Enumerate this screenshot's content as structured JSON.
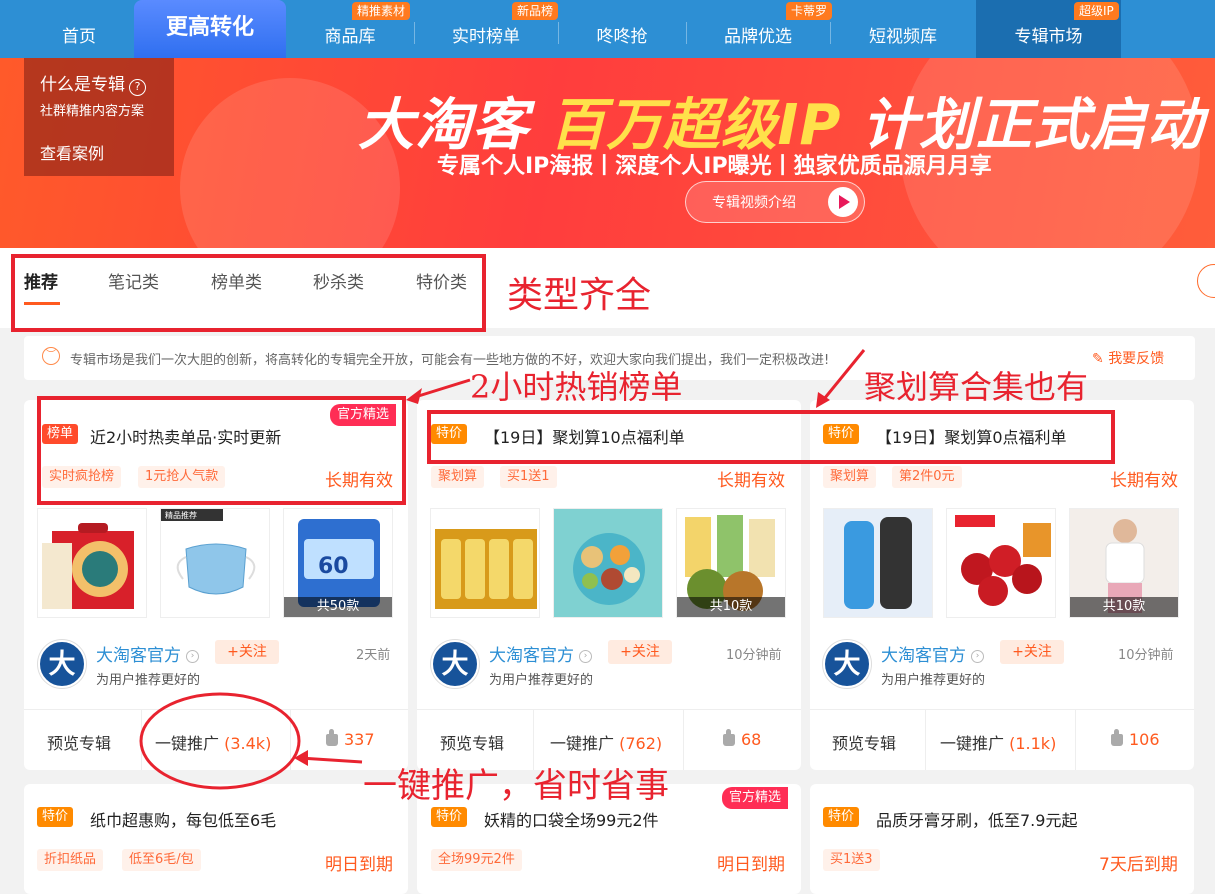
{
  "nav": {
    "items": [
      {
        "label": "首页",
        "badge": ""
      },
      {
        "label": "更高转化",
        "badge": ""
      },
      {
        "label": "商品库",
        "badge": "精推素材"
      },
      {
        "label": "实时榜单",
        "badge": "新品榜"
      },
      {
        "label": "咚咚抢",
        "badge": ""
      },
      {
        "label": "品牌优选",
        "badge": "卡蒂罗"
      },
      {
        "label": "短视频库",
        "badge": ""
      },
      {
        "label": "专辑市场",
        "badge": "超级IP"
      }
    ]
  },
  "banner": {
    "side": {
      "title": "什么是专辑",
      "help": "?",
      "subtitle": "社群精推内容方案",
      "link": "查看案例"
    },
    "title_a": "大淘客 ",
    "title_gold": "百万超级IP",
    "title_b": " 计划正式启动",
    "subtitle": "专属个人IP海报丨深度个人IP曝光丨独家优质品源月月享",
    "video_button": "专辑视频介绍"
  },
  "tabs": [
    "推荐",
    "笔记类",
    "榜单类",
    "秒杀类",
    "特价类"
  ],
  "notice": {
    "icon": "smile-icon",
    "text": "专辑市场是我们一次大胆的创新，将高转化的专辑完全开放，可能会有一些地方做的不好，欢迎大家向我们提出，我们一定积极改进!",
    "feedback": "我要反馈"
  },
  "annotations": {
    "types": "类型齐全",
    "hot": "2小时热销榜单",
    "juhuasuan": "聚划算合集也有",
    "one_click": "一键推广，省时省事"
  },
  "cards": [
    {
      "tag": "榜单",
      "title": "近2小时热卖单品·实时更新",
      "official": "官方精选",
      "pills": [
        "实时疯抢榜",
        "1元抢人气款"
      ],
      "validity": "长期有效",
      "count": "共50款",
      "author": "大淘客官方",
      "avatar": "大",
      "follow": "+关注",
      "ago": "2天前",
      "desc": "为用户推荐更好的",
      "preview": "预览专辑",
      "promote": "一键推广",
      "promote_count": "(3.4k)",
      "likes": "337"
    },
    {
      "tag": "特价",
      "title": "【19日】聚划算10点福利单",
      "official": "",
      "pills": [
        "聚划算",
        "买1送1"
      ],
      "validity": "长期有效",
      "count": "共10款",
      "author": "大淘客官方",
      "avatar": "大",
      "follow": "+关注",
      "ago": "10分钟前",
      "desc": "为用户推荐更好的",
      "preview": "预览专辑",
      "promote": "一键推广",
      "promote_count": "(762)",
      "likes": "68"
    },
    {
      "tag": "特价",
      "title": "【19日】聚划算0点福利单",
      "official": "",
      "pills": [
        "聚划算",
        "第2件0元"
      ],
      "validity": "长期有效",
      "count": "共10款",
      "author": "大淘客官方",
      "avatar": "大",
      "follow": "+关注",
      "ago": "10分钟前",
      "desc": "为用户推荐更好的",
      "preview": "预览专辑",
      "promote": "一键推广",
      "promote_count": "(1.1k)",
      "likes": "106"
    },
    {
      "tag": "特价",
      "title": "纸巾超惠购，每包低至6毛",
      "official": "",
      "pills": [
        "折扣纸品",
        "低至6毛/包"
      ],
      "validity": "明日到期"
    },
    {
      "tag": "特价",
      "title": "妖精的口袋全场99元2件",
      "official": "官方精选",
      "pills": [
        "全场99元2件"
      ],
      "validity": "明日到期"
    },
    {
      "tag": "特价",
      "title": "品质牙膏牙刷，低至7.9元起",
      "official": "",
      "pills": [
        "买1送3"
      ],
      "validity": "7天后到期"
    }
  ],
  "thumb_labels": [
    "精品推荐"
  ]
}
